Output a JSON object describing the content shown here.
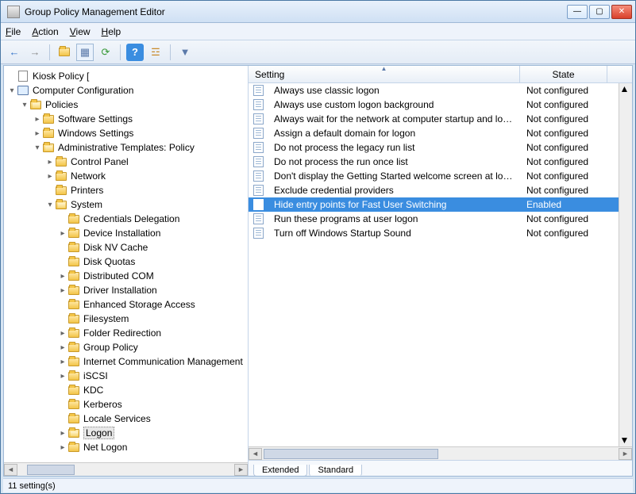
{
  "window": {
    "title": "Group Policy Management Editor"
  },
  "menu": {
    "file": "File",
    "action": "Action",
    "view": "View",
    "help": "Help"
  },
  "toolbar_icons": {
    "back": "←",
    "forward": "→",
    "up": "⇧",
    "show": "▦",
    "export": "⇪",
    "help": "?",
    "props": "☰",
    "filter": "▿"
  },
  "tree": {
    "root": "Kiosk Policy [",
    "computer_config": "Computer Configuration",
    "policies": "Policies",
    "software": "Software Settings",
    "windows": "Windows Settings",
    "admin": "Administrative Templates: Policy",
    "control_panel": "Control Panel",
    "network": "Network",
    "printers": "Printers",
    "system": "System",
    "system_children": [
      "Credentials Delegation",
      "Device Installation",
      "Disk NV Cache",
      "Disk Quotas",
      "Distributed COM",
      "Driver Installation",
      "Enhanced Storage Access",
      "Filesystem",
      "Folder Redirection",
      "Group Policy",
      "Internet Communication Management",
      "iSCSI",
      "KDC",
      "Kerberos",
      "Locale Services",
      "Logon",
      "Net Logon"
    ],
    "selected_child": "Logon"
  },
  "list": {
    "columns": {
      "setting": "Setting",
      "state": "State"
    },
    "rows": [
      {
        "setting": "Always use classic logon",
        "state": "Not configured"
      },
      {
        "setting": "Always use custom logon background",
        "state": "Not configured"
      },
      {
        "setting": "Always wait for the network at computer startup and logon",
        "state": "Not configured"
      },
      {
        "setting": "Assign a default domain for logon",
        "state": "Not configured"
      },
      {
        "setting": "Do not process the legacy run list",
        "state": "Not configured"
      },
      {
        "setting": "Do not process the run once list",
        "state": "Not configured"
      },
      {
        "setting": "Don't display the Getting Started welcome screen at logon",
        "state": "Not configured"
      },
      {
        "setting": "Exclude credential providers",
        "state": "Not configured"
      },
      {
        "setting": "Hide entry points for Fast User Switching",
        "state": "Enabled",
        "selected": true
      },
      {
        "setting": "Run these programs at user logon",
        "state": "Not configured"
      },
      {
        "setting": "Turn off Windows Startup Sound",
        "state": "Not configured"
      }
    ]
  },
  "tabs": {
    "extended": "Extended",
    "standard": "Standard",
    "active": "standard"
  },
  "status": "11 setting(s)"
}
